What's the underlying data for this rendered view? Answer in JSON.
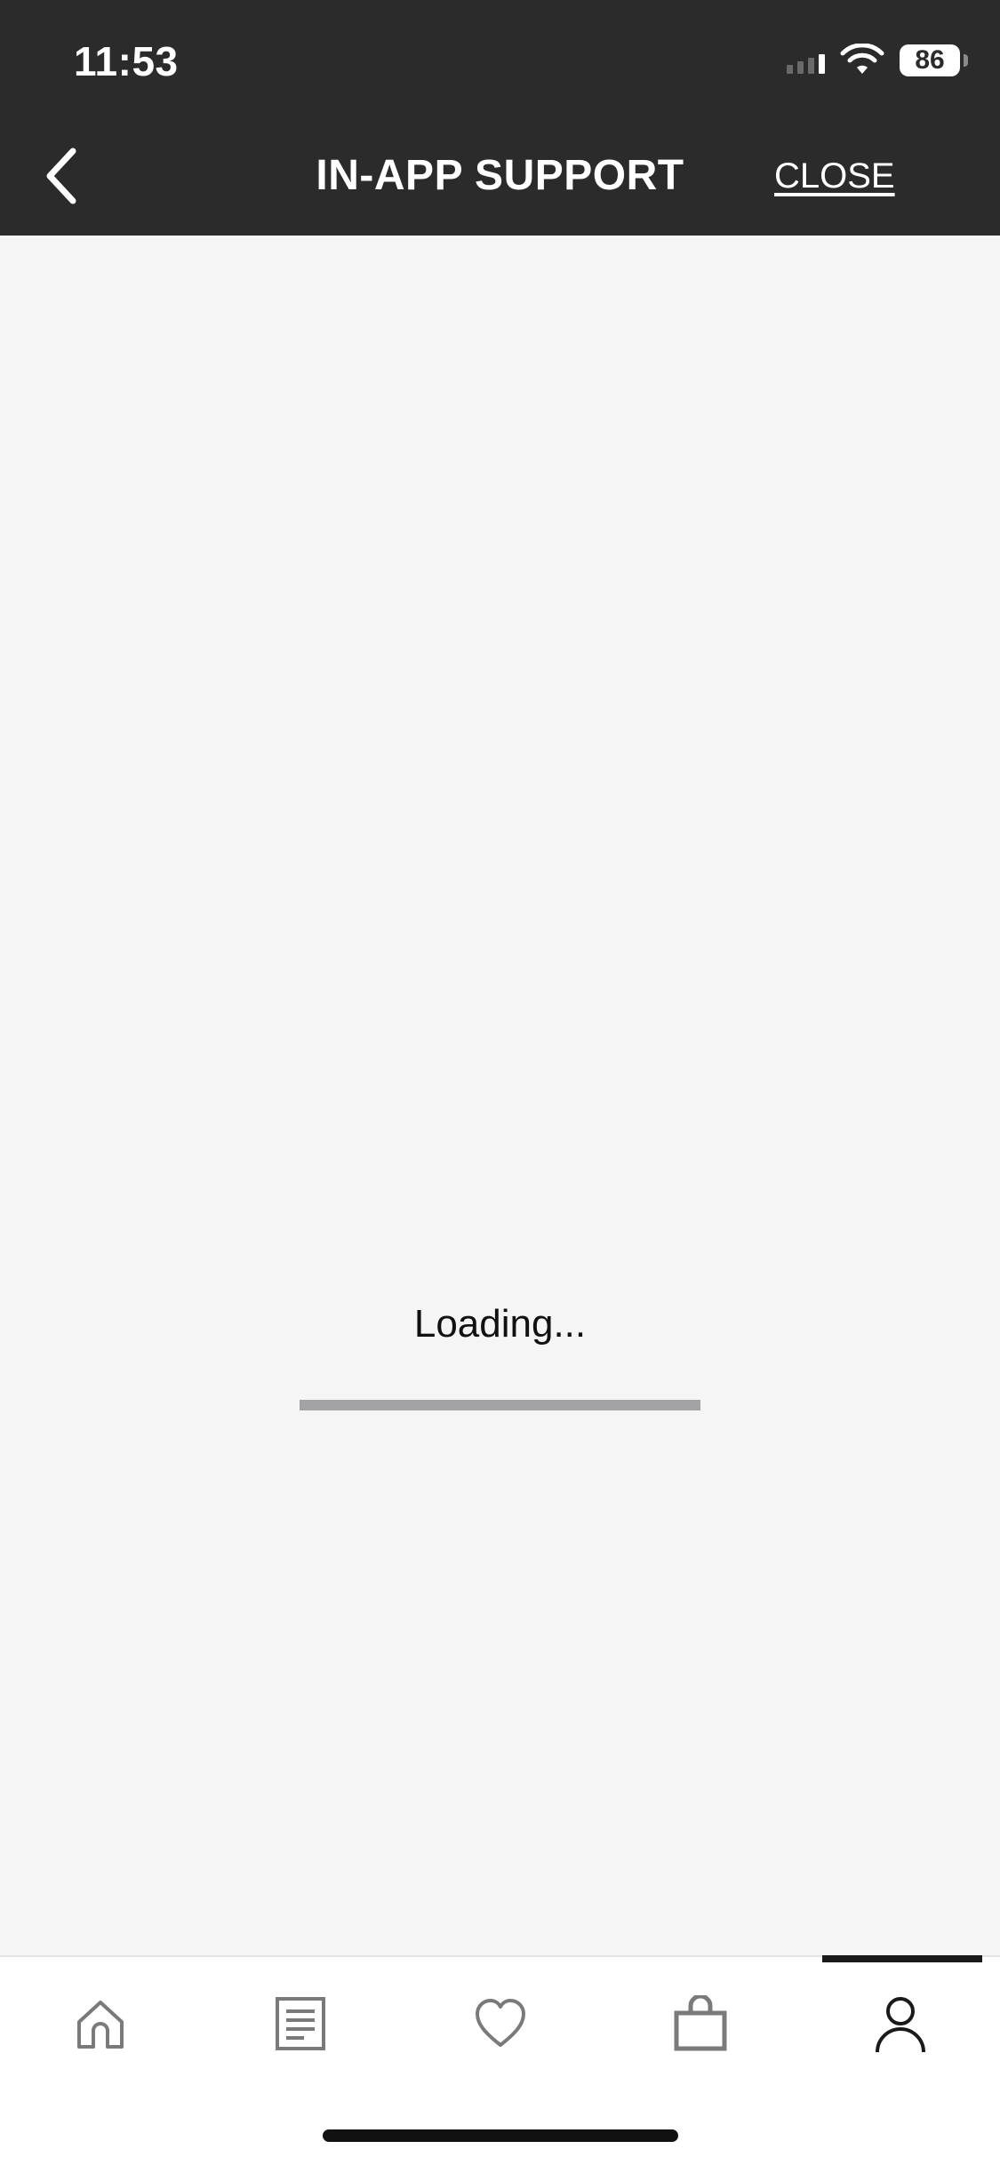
{
  "status_bar": {
    "time": "11:53",
    "battery": "86"
  },
  "header": {
    "title": "IN-APP SUPPORT",
    "close_label": "CLOSE"
  },
  "content": {
    "loading_text": "Loading...",
    "progress_percent": 100
  },
  "tabbar": {
    "tabs": [
      {
        "icon": "home-icon",
        "selected": false
      },
      {
        "icon": "catalog-icon",
        "selected": false
      },
      {
        "icon": "heart-icon",
        "selected": false
      },
      {
        "icon": "bag-icon",
        "selected": false
      },
      {
        "icon": "profile-icon",
        "selected": true
      }
    ]
  },
  "colors": {
    "header_bg": "#2b2b2b",
    "content_bg": "#f5f5f5",
    "progress_fill": "#a3a3a5",
    "tab_icon": "#7a7a7a",
    "tab_icon_active": "#1a1a1a"
  }
}
